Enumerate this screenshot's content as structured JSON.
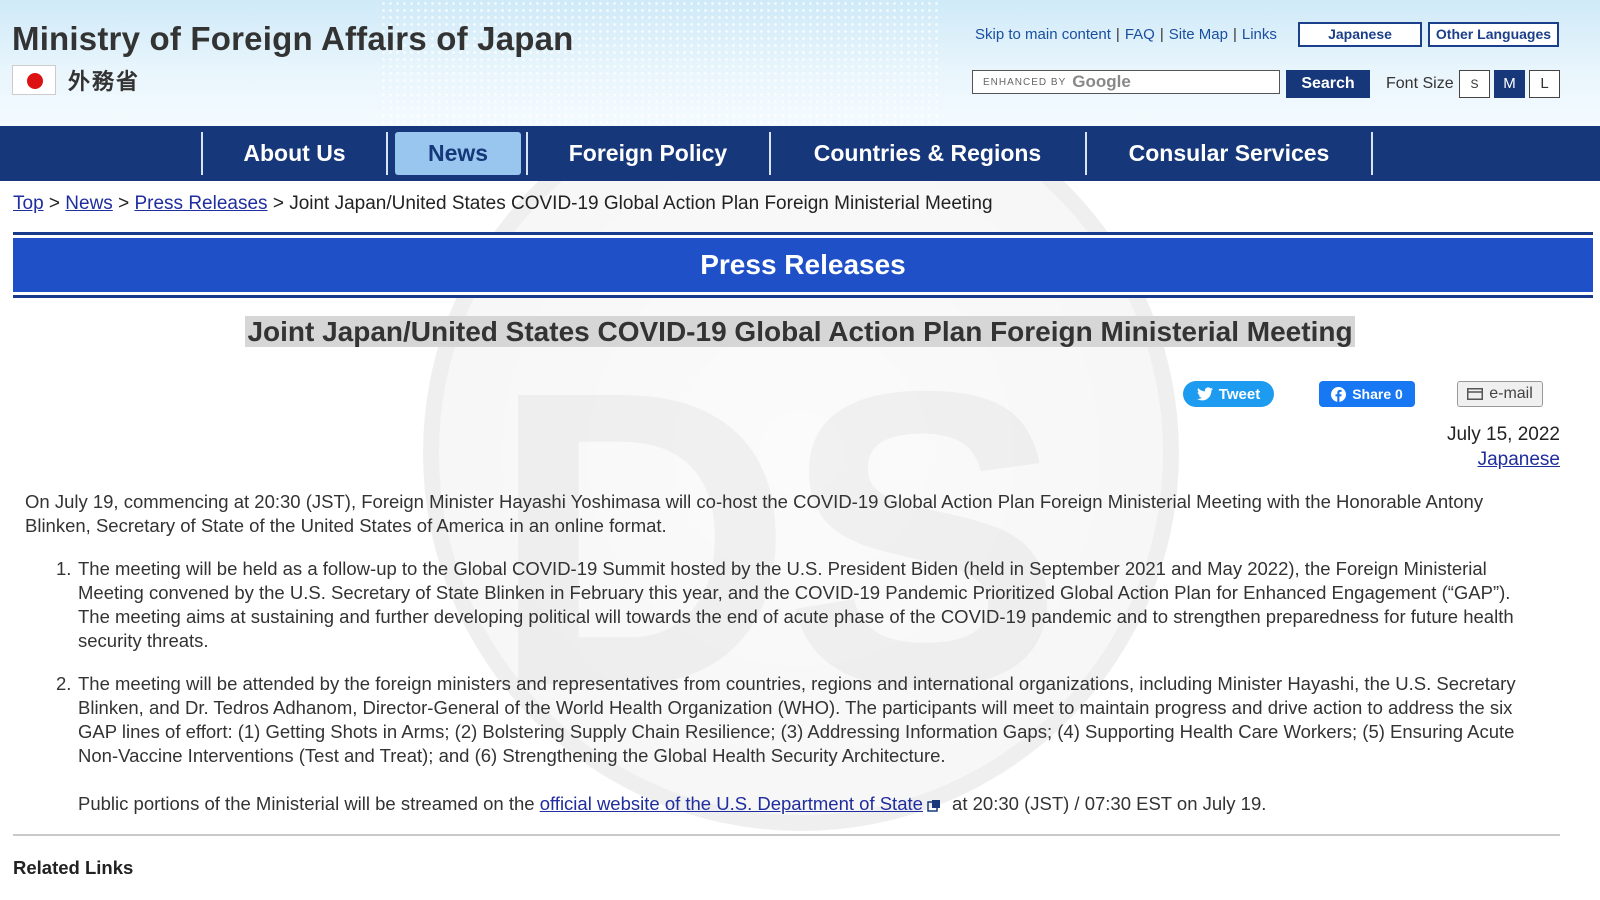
{
  "header": {
    "site_title": "Ministry of Foreign Affairs of Japan",
    "site_title_jp": "外務省",
    "top_links": [
      "Skip to main content",
      "FAQ",
      "Site Map",
      "Links"
    ],
    "lang_japanese": "Japanese",
    "lang_other": "Other Languages",
    "search_enhanced": "ENHANCED BY",
    "search_google": "Google",
    "search_button": "Search",
    "font_size_label": "Font Size",
    "font_sizes": [
      "S",
      "M",
      "L"
    ],
    "font_size_active": "M"
  },
  "nav": {
    "items": [
      "About Us",
      "News",
      "Foreign Policy",
      "Countries & Regions",
      "Consular Services"
    ],
    "active": "News"
  },
  "breadcrumb": {
    "items": [
      "Top",
      "News",
      "Press Releases"
    ],
    "current": "Joint Japan/United States COVID-19 Global Action Plan Foreign Ministerial Meeting"
  },
  "banner": "Press Releases",
  "page_title": "Joint Japan/United States COVID-19 Global Action Plan Foreign Ministerial Meeting",
  "share": {
    "tweet": "Tweet",
    "facebook": "Share 0",
    "email": "e-mail"
  },
  "date": "July 15, 2022",
  "japanese_link": "Japanese",
  "content": {
    "intro": "On July 19, commencing at 20:30 (JST), Foreign Minister Hayashi Yoshimasa will co-host the COVID-19 Global Action Plan Foreign Ministerial Meeting with the Honorable Antony Blinken, Secretary of State of the United States of America in an online format.",
    "list": [
      {
        "num": "1.",
        "text": "The meeting will be held as a follow-up to the Global COVID-19 Summit hosted by the U.S. President Biden (held in September 2021 and May 2022), the Foreign Ministerial Meeting convened by the U.S. Secretary of State Blinken in February this year, and the COVID-19 Pandemic Prioritized Global Action Plan for Enhanced Engagement (“GAP”). The meeting aims at sustaining and further developing political will towards the end of acute phase of the COVID-19 pandemic and to strengthen preparedness for future health security threats."
      },
      {
        "num": "2.",
        "text": "The meeting will be attended by the foreign ministers and representatives from countries, regions and international organizations, including Minister Hayashi, the U.S. Secretary Blinken, and Dr. Tedros Adhanom, Director-General of the World Health Organization (WHO). The participants will meet to maintain progress and drive action to address the six GAP lines of effort: (1) Getting Shots in Arms; (2) Bolstering Supply Chain Resilience; (3) Addressing Information Gaps; (4) Supporting Health Care Workers; (5) Ensuring Acute Non-Vaccine Interventions (Test and Treat); and (6) Strengthening the Global Health Security Architecture."
      }
    ],
    "stream_before": "Public portions of the Ministerial will be streamed on the ",
    "stream_link": "official website of the U.S. Department of State",
    "stream_after": " at 20:30 (JST) / 07:30 EST on July 19."
  },
  "related_links": "Related Links",
  "watermark": "DS",
  "colors": {
    "nav_bg": "#16387a",
    "banner_bg": "#1f50c8",
    "nav_active": "#98c6ee",
    "link": "#1f2d9e"
  }
}
